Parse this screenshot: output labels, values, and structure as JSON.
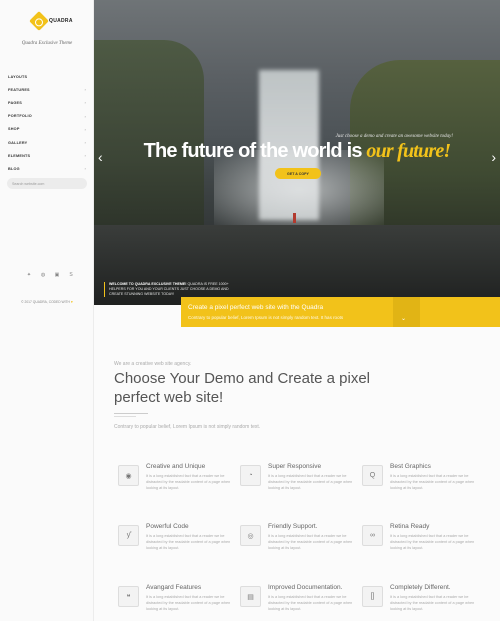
{
  "brand": {
    "name": "QUADRA",
    "tagline": "Quadra Exclusive Theme"
  },
  "sidebar": {
    "items": [
      {
        "label": "LAYOUTS",
        "has_arrow": false
      },
      {
        "label": "FEATURES",
        "has_arrow": true
      },
      {
        "label": "PAGES",
        "has_arrow": true
      },
      {
        "label": "PORTFOLIO",
        "has_arrow": true
      },
      {
        "label": "SHOP",
        "has_arrow": true
      },
      {
        "label": "GALLERY",
        "has_arrow": true
      },
      {
        "label": "ELEMENTS",
        "has_arrow": true
      },
      {
        "label": "BLOG",
        "has_arrow": true
      }
    ],
    "search_placeholder": "Search website.com",
    "social_icons": [
      "twitter-icon",
      "dribbble-icon",
      "instagram-icon",
      "skype-icon"
    ],
    "copyright": "© 2017 QUADRA, CODED WITH",
    "heart": "♥"
  },
  "hero": {
    "subtitle": "Just choose a demo and create an awesome website today!",
    "title_main": "The future of the world is ",
    "title_accent": "our future!",
    "cta_label": "GET A COPY",
    "arrow_left": "‹",
    "arrow_right": "›",
    "welcome_bold": "WELCOME TO QUADRA EXCLUSIVE THEME!",
    "welcome_rest": " QUADRA IS FREE 1000+ HELPERS FOR YOU AND YOUR CLIENTS JUST CHOOSE A DEMO AND CREATE STUNNING WEBSITE TODAY!",
    "bar_title": "Create a pixel perfect web site with the Quadra",
    "bar_subtitle": "Contrary to popular belief, Lorem Ipsum is not simply random text. It has roots",
    "bar_chevron": "⌄"
  },
  "intro": {
    "eyebrow": "We are a creative web site agency.",
    "heading": "Choose Your Demo and Create a pixel perfect web site!",
    "lead": "Contrary to popular belief, Lorem Ipsum is not simply random text."
  },
  "features": [
    {
      "title": "Creative and Unique",
      "text": "It is a long established fact that a reader we be distracted by the readable content of a page when looking at its layout.",
      "icon": "target-icon",
      "glyph": "◉"
    },
    {
      "title": "Super Responsive",
      "text": "It is a long established fact that a reader we be distracted by the readable content of a page when looking at its layout.",
      "icon": "compass-icon",
      "glyph": "◔"
    },
    {
      "title": "Best Graphics",
      "text": "It is a long established fact that a reader we be distracted by the readable content of a page when looking at its layout.",
      "icon": "magnifier-icon",
      "glyph": "Q"
    },
    {
      "title": "Powerful Code",
      "text": "It is a long established fact that a reader we be distracted by the readable content of a page when looking at its layout.",
      "icon": "code-icon",
      "glyph": "ƴ"
    },
    {
      "title": "Friendly Support.",
      "text": "It is a long established fact that a reader we be distracted by the readable content of a page when looking at its layout.",
      "icon": "lifebuoy-icon",
      "glyph": "◎"
    },
    {
      "title": "Retina Ready",
      "text": "It is a long established fact that a reader we be distracted by the readable content of a page when looking at its layout.",
      "icon": "glasses-icon",
      "glyph": "∞"
    },
    {
      "title": "Avangard Features",
      "text": "It is a long established fact that a reader we be distracted by the readable content of a page when looking at its layout.",
      "icon": "chat-icon",
      "glyph": "❝"
    },
    {
      "title": "Improved Documentation.",
      "text": "It is a long established fact that a reader we be distracted by the readable content of a page when looking at its layout.",
      "icon": "document-icon",
      "glyph": "▤"
    },
    {
      "title": "Completely Different.",
      "text": "It is a long established fact that a reader we be distracted by the readable content of a page when looking at its layout.",
      "icon": "code-brackets-icon",
      "glyph": "[]"
    }
  ]
}
